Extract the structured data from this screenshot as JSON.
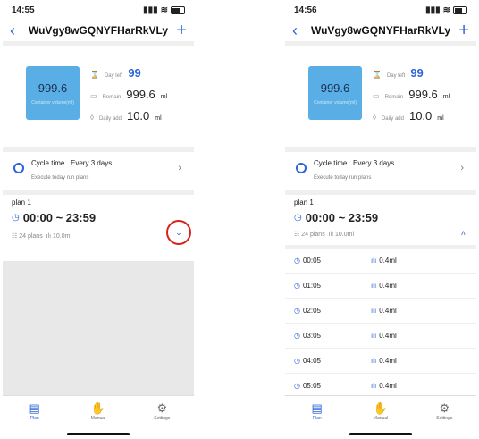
{
  "screens": [
    {
      "time": "14:55",
      "title": "WuVgy8wGQNYFHarRkVLy",
      "container": {
        "value": "999.6",
        "label": "Container volume(ml)"
      },
      "stats": {
        "day_left_label": "Day left",
        "day_left_value": "99",
        "remain_label": "Remain",
        "remain_value": "999.6",
        "remain_unit": "ml",
        "daily_label": "Daily add",
        "daily_value": "10.0",
        "daily_unit": "ml"
      },
      "cycle": {
        "label": "Cycle time",
        "value": "Every 3 days",
        "sub": "Execute today run plans"
      },
      "plan": {
        "name": "plan 1",
        "time": "00:00 ~ 23:59",
        "count": "24 plans",
        "amount": "10.0ml"
      },
      "tabs": [
        "Plan",
        "Manual",
        "Settings"
      ]
    },
    {
      "time": "14:56",
      "title": "WuVgy8wGQNYFHarRkVLy",
      "container": {
        "value": "999.6",
        "label": "Container volume(ml)"
      },
      "stats": {
        "day_left_label": "Day left",
        "day_left_value": "99",
        "remain_label": "Remain",
        "remain_value": "999.6",
        "remain_unit": "ml",
        "daily_label": "Daily add",
        "daily_value": "10.0",
        "daily_unit": "ml"
      },
      "cycle": {
        "label": "Cycle time",
        "value": "Every 3 days",
        "sub": "Execute today run plans"
      },
      "plan": {
        "name": "plan 1",
        "time": "00:00 ~ 23:59",
        "count": "24 plans",
        "amount": "10.0ml"
      },
      "schedule": [
        {
          "time": "00:05",
          "amount": "0.4ml"
        },
        {
          "time": "01:05",
          "amount": "0.4ml"
        },
        {
          "time": "02:05",
          "amount": "0.4ml"
        },
        {
          "time": "03:05",
          "amount": "0.4ml"
        },
        {
          "time": "04:05",
          "amount": "0.4ml"
        },
        {
          "time": "05:05",
          "amount": "0.4ml"
        }
      ],
      "tabs": [
        "Plan",
        "Manual",
        "Settings"
      ]
    }
  ],
  "icons": {
    "back": "chevron-left-icon",
    "add": "plus-icon",
    "expand": "chevron-down-icon",
    "collapse": "chevron-up-icon"
  },
  "colors": {
    "accent": "#2c64d8",
    "container": "#5aaee6",
    "highlight_ring": "#d9221d"
  }
}
